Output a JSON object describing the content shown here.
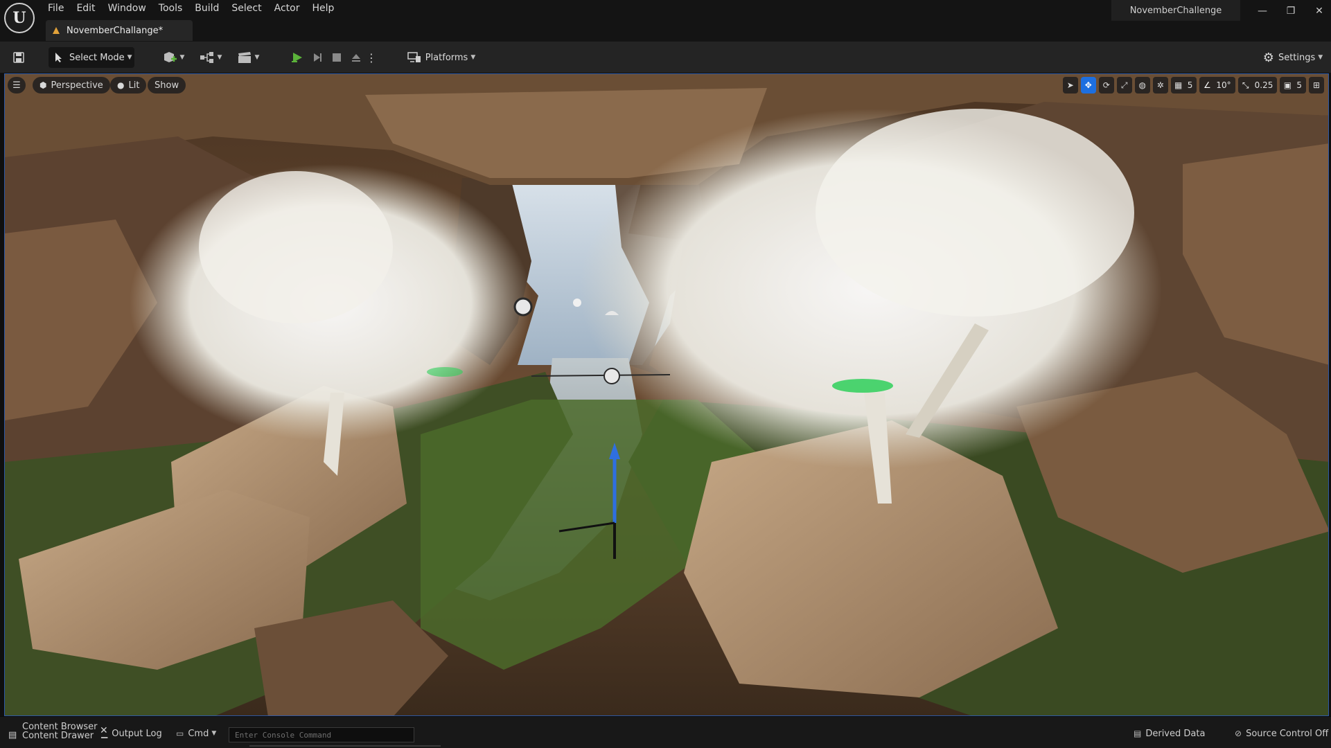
{
  "app": {
    "logo_letter": "U",
    "project_name": "NovemberChallenge",
    "document_tab": "NovemberChallange*"
  },
  "menu": [
    "File",
    "Edit",
    "Window",
    "Tools",
    "Build",
    "Select",
    "Actor",
    "Help"
  ],
  "window_controls": {
    "minimize": "—",
    "restore": "❐",
    "close": "✕"
  },
  "toolbar": {
    "select_mode": "Select Mode",
    "platforms": "Platforms",
    "settings": "Settings"
  },
  "viewport": {
    "perspective": "Perspective",
    "lit": "Lit",
    "show": "Show",
    "grid_snap": "5",
    "rotation_snap": "10°",
    "scale_snap": "0.25",
    "camera_speed": "5"
  },
  "statusbar": {
    "content_browser": "Content Browser",
    "content_drawer": "Content Drawer",
    "output_log": "Output Log",
    "cmd": "Cmd",
    "console_placeholder": "Enter Console Command",
    "derived_data": "Derived Data",
    "source_control": "Source Control Off"
  },
  "colors": {
    "accent": "#1d6fe0",
    "play_green": "#5bb33a",
    "viewport_border": "#2e5aa8"
  }
}
